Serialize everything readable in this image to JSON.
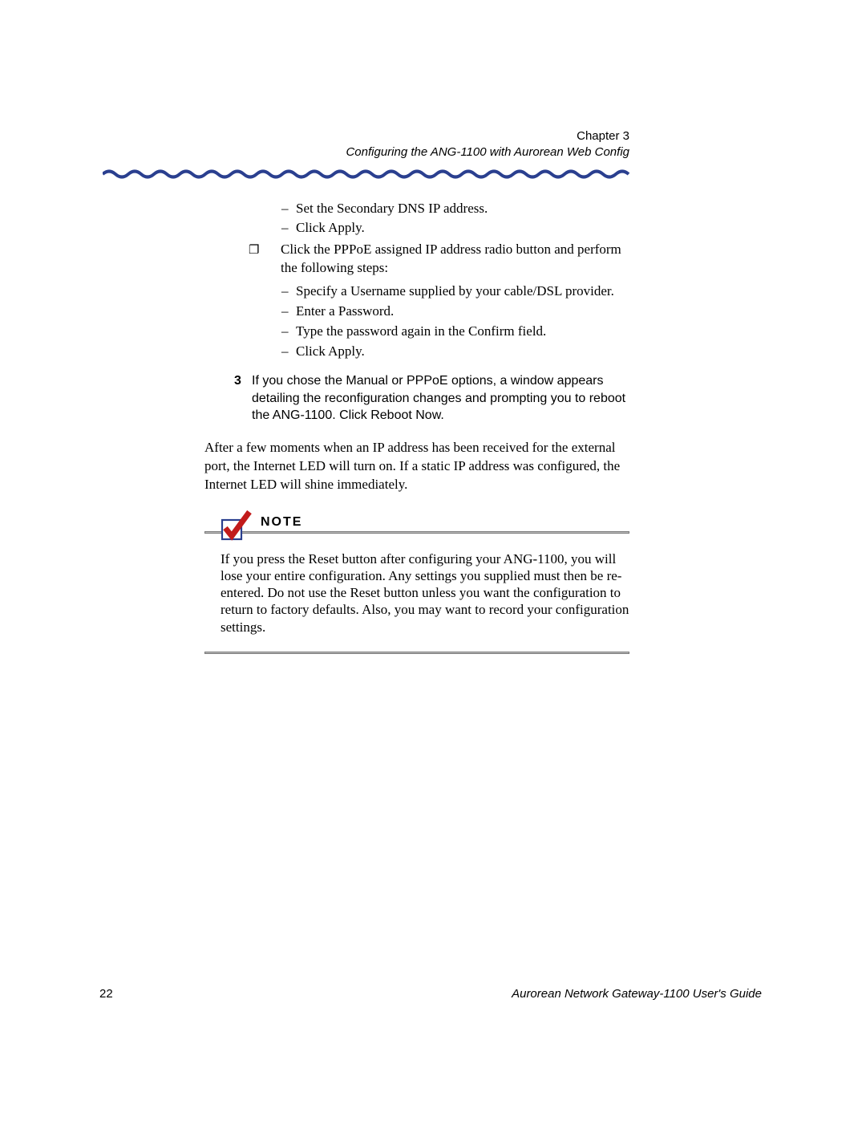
{
  "header": {
    "chapter": "Chapter 3",
    "subtitle": "Configuring the ANG-1100 with Aurorean Web Config"
  },
  "list1": {
    "a": "Set the Secondary DNS IP address.",
    "b": "Click Apply."
  },
  "box": {
    "lead": "Click the PPPoE assigned IP address radio button and perform the following steps:",
    "sub": {
      "a": "Specify a Username supplied by your cable/DSL provider.",
      "b": "Enter a Password.",
      "c": "Type the password again in the Confirm field.",
      "d": "Click Apply."
    }
  },
  "step3": {
    "num": "3",
    "text": "If you chose the Manual or PPPoE options, a window appears detailing the reconfiguration changes and prompting you to reboot the ANG-1100. Click Reboot Now."
  },
  "para": "After a few moments when an IP address has been received for the external port, the Internet LED will turn on. If a static IP address was configured, the Internet LED will shine immediately.",
  "note": {
    "label": "NOTE",
    "body": "If you press the Reset button after configuring your ANG-1100, you will lose your entire configuration. Any settings you supplied must then be re-entered. Do not use the Reset button unless you want the configuration to return to factory defaults. Also, you may want to record your configuration settings."
  },
  "footer": {
    "page": "22",
    "title": "Aurorean Network Gateway-1100 User's Guide"
  }
}
